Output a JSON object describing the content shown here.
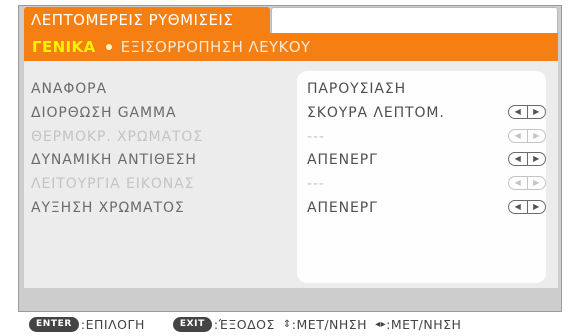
{
  "window": {
    "title": "ΛΕΠΤΟΜΕΡΕΙΣ ΡΥΘΜΙΣΕΙΣ"
  },
  "tabs": {
    "active": "ΓΕΝΙΚΑ",
    "inactive": "ΕΞΙΣΟΡΡΟΠΗΣΗ ΛΕΥΚΟΥ"
  },
  "settings": [
    {
      "label": "ΑΝΑΦΟΡΑ",
      "value": "ΠΑΡΟΥΣΙΑΣΗ",
      "has_arrows": false,
      "enabled": true
    },
    {
      "label": "ΔΙΟΡΘΩΣΗ GAMMA",
      "value": "ΣΚΟΥΡΑ ΛΕΠΤΟΜ.",
      "has_arrows": true,
      "enabled": true
    },
    {
      "label": "ΘΕΡΜΟΚΡ. ΧΡΩΜΑΤΟΣ",
      "value": "---",
      "has_arrows": true,
      "enabled": false
    },
    {
      "label": "ΔΥΝΑΜΙΚΗ ΑΝΤΙΘΕΣΗ",
      "value": "ΑΠΕΝΕΡΓ",
      "has_arrows": true,
      "enabled": true
    },
    {
      "label": "ΛΕΙΤΟΥΡΓΙΑ ΕΙΚΟΝΑΣ",
      "value": "---",
      "has_arrows": true,
      "enabled": false
    },
    {
      "label": "ΑΥΞΗΣΗ ΧΡΩΜΑΤΟΣ",
      "value": "ΑΠΕΝΕΡΓ",
      "has_arrows": true,
      "enabled": true
    }
  ],
  "arrows": {
    "left": "◀",
    "right": "▶"
  },
  "footer": {
    "enter_key": "ENTER",
    "enter_text": ":ΕΠΙΛΟΓΗ",
    "exit_key": "EXIT",
    "exit_text": ":ΈΞΟΔΟΣ",
    "updown_icon": "⇕",
    "updown_text": ":ΜΕΤ/ΝΗΣΗ",
    "leftright_icon": "◂▸",
    "leftright_text": ":ΜΕΤ/ΝΗΣΗ"
  },
  "colors": {
    "accent": "#f57f12",
    "active_tab_text": "#ffef00",
    "panel": "#ececec",
    "value_column": "#fefefe",
    "label_text": "#6b6b6b",
    "disabled_text": "#c4c4c4"
  }
}
